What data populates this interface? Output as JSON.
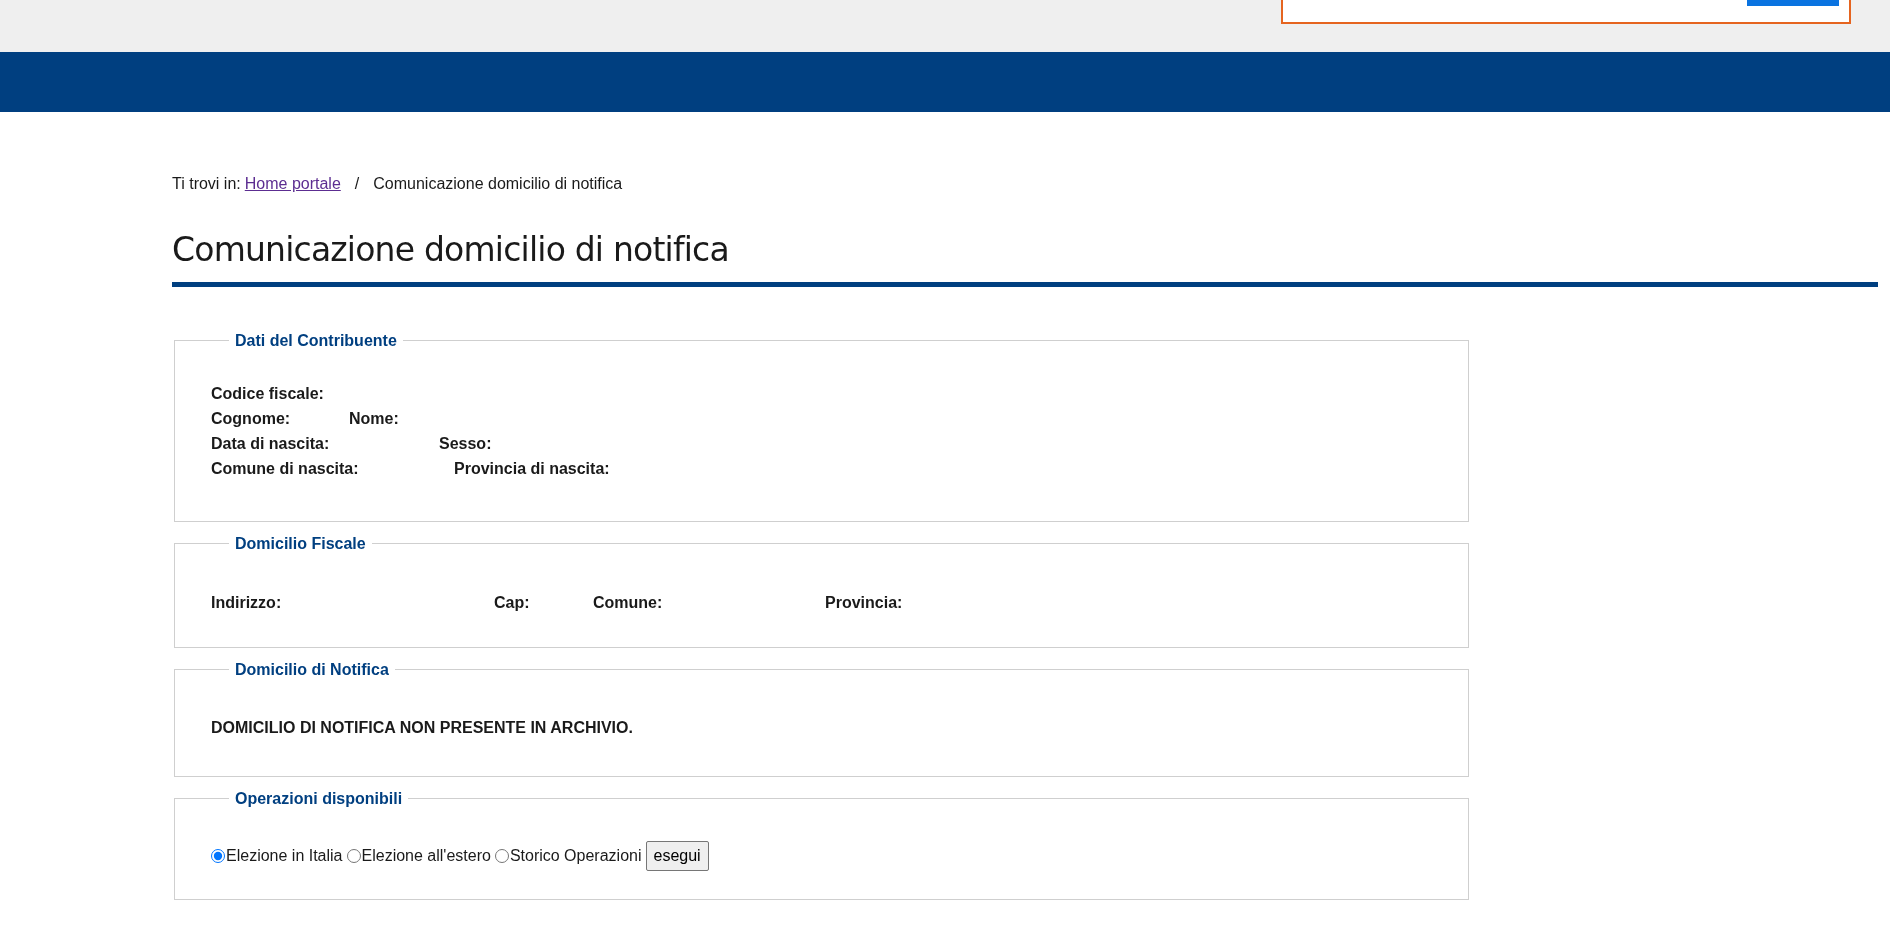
{
  "breadcrumb": {
    "prefix": "Ti trovi in:",
    "items": [
      {
        "label": "Home portale",
        "kind": "link"
      },
      {
        "label": "Comunicazione domicilio di notifica",
        "kind": "current"
      }
    ],
    "separator": "/"
  },
  "page_title": "Comunicazione domicilio di notifica",
  "sections": [
    {
      "legend": "Dati del Contribuente",
      "kind": "fields",
      "rows": [
        [
          "Codice fiscale:"
        ],
        [
          "Cognome:",
          "Nome:"
        ],
        [
          "Data di nascita:",
          "Sesso:"
        ],
        [
          "Comune di nascita:",
          "Provincia di nascita:"
        ]
      ]
    },
    {
      "legend": "Domicilio Fiscale",
      "kind": "fields",
      "rows": [
        [
          "Indirizzo:",
          "Cap:",
          "Comune:",
          "Provincia:"
        ]
      ]
    },
    {
      "legend": "Domicilio di Notifica",
      "kind": "message",
      "message": "DOMICILIO DI NOTIFICA NON PRESENTE IN ARCHIVIO."
    },
    {
      "legend": "Operazioni disponibili",
      "kind": "operations",
      "options": [
        {
          "label": "Elezione in Italia",
          "selected": true
        },
        {
          "label": "Elezione all'estero",
          "selected": false
        },
        {
          "label": "Storico Operazioni",
          "selected": false
        }
      ],
      "button": "esegui"
    }
  ]
}
